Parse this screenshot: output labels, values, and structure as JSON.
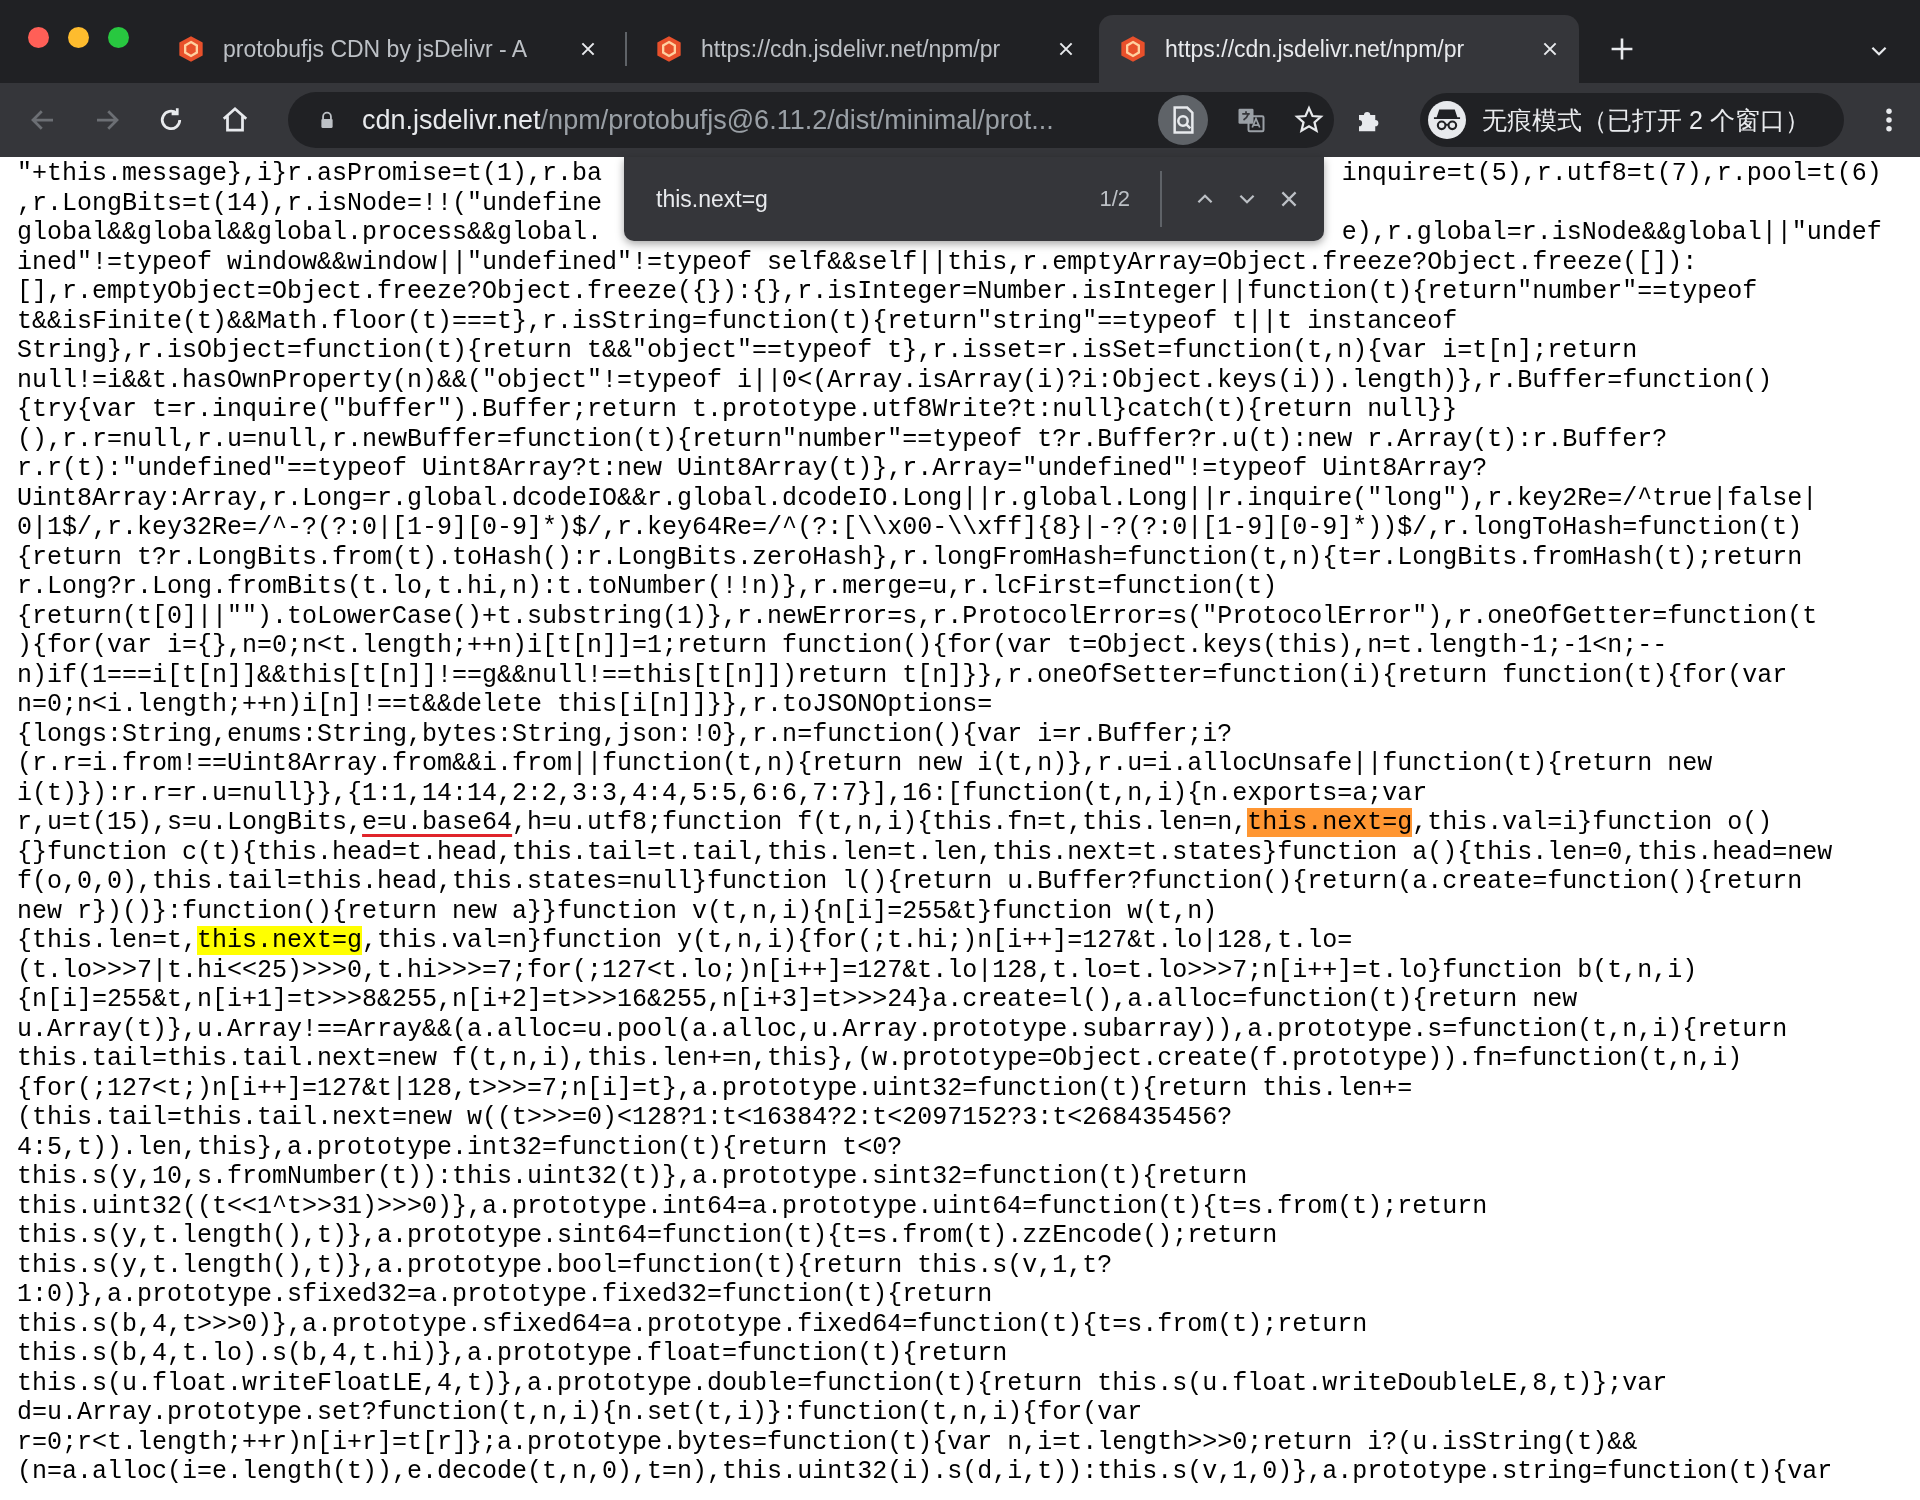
{
  "tabs": [
    {
      "title": "protobufjs CDN by jsDelivr - A",
      "selected": false
    },
    {
      "title": "https://cdn.jsdelivr.net/npm/pr",
      "selected": false
    },
    {
      "title": "https://cdn.jsdelivr.net/npm/pr",
      "selected": true
    }
  ],
  "nav_buttons": [
    {
      "kind": "back",
      "disabled": true
    },
    {
      "kind": "forward",
      "disabled": true
    },
    {
      "kind": "reload",
      "disabled": false
    },
    {
      "kind": "home",
      "disabled": false
    }
  ],
  "address_bar": {
    "host": "cdn.jsdelivr.net",
    "path": "/npm/protobufjs@6.11.2/dist/minimal/prot..."
  },
  "profile": {
    "label": "无痕模式（已打开 2 个窗口）"
  },
  "find_bar": {
    "query": "this.next=g",
    "count": "1/2"
  },
  "source_lines": [
    {
      "segments": [
        {
          "kind": "text",
          "text": "\"+this.message},i}r.asPromise=t(1),r.ba"
        }
      ],
      "right_text": "inquire=t(5),r.utf8=t(7),r.pool=t(6)"
    },
    {
      "segments": [
        {
          "kind": "text",
          "text": ",r.LongBits=t(14),r.isNode=!!(\"undefine"
        }
      ]
    },
    {
      "segments": [
        {
          "kind": "text",
          "text": "global&&global&&global.process&&global."
        }
      ],
      "right_text": "e),r.global=r.isNode&&global||\"undef"
    },
    {
      "segments": [
        {
          "kind": "text",
          "text": "ined\"!=typeof window&&window||\"undefined\"!=typeof self&&self||this,r.emptyArray=Object.freeze?Object.freeze([]):"
        }
      ]
    },
    {
      "segments": [
        {
          "kind": "text",
          "text": "[],r.emptyObject=Object.freeze?Object.freeze({}):{},r.isInteger=Number.isInteger||function(t){return\"number\"==typeof"
        }
      ]
    },
    {
      "segments": [
        {
          "kind": "text",
          "text": "t&&isFinite(t)&&Math.floor(t)===t},r.isString=function(t){return\"string\"==typeof t||t instanceof"
        }
      ]
    },
    {
      "segments": [
        {
          "kind": "text",
          "text": "String},r.isObject=function(t){return t&&\"object\"==typeof t},r.isset=r.isSet=function(t,n){var i=t[n];return"
        }
      ]
    },
    {
      "segments": [
        {
          "kind": "text",
          "text": "null!=i&&t.hasOwnProperty(n)&&(\"object\"!=typeof i||0<(Array.isArray(i)?i:Object.keys(i)).length)},r.Buffer=function()"
        }
      ]
    },
    {
      "segments": [
        {
          "kind": "text",
          "text": "{try{var t=r.inquire(\"buffer\").Buffer;return t.prototype.utf8Write?t:null}catch(t){return null}}"
        }
      ]
    },
    {
      "segments": [
        {
          "kind": "text",
          "text": "(),r.r=null,r.u=null,r.newBuffer=function(t){return\"number\"==typeof t?r.Buffer?r.u(t):new r.Array(t):r.Buffer?"
        }
      ]
    },
    {
      "segments": [
        {
          "kind": "text",
          "text": "r.r(t):\"undefined\"==typeof Uint8Array?t:new Uint8Array(t)},r.Array=\"undefined\"!=typeof Uint8Array?"
        }
      ]
    },
    {
      "segments": [
        {
          "kind": "text",
          "text": "Uint8Array:Array,r.Long=r.global.dcodeIO&&r.global.dcodeIO.Long||r.global.Long||r.inquire(\"long\"),r.key2Re=/^true|false|"
        }
      ]
    },
    {
      "segments": [
        {
          "kind": "text",
          "text": "0|1$/,r.key32Re=/^-?(?:0|[1-9][0-9]*)$/,r.key64Re=/^(?:[\\\\x00-\\\\xff]{8}|-?(?:0|[1-9][0-9]*))$/,r.longToHash=function(t)"
        }
      ]
    },
    {
      "segments": [
        {
          "kind": "text",
          "text": "{return t?r.LongBits.from(t).toHash():r.LongBits.zeroHash},r.longFromHash=function(t,n){t=r.LongBits.fromHash(t);return"
        }
      ]
    },
    {
      "segments": [
        {
          "kind": "text",
          "text": "r.Long?r.Long.fromBits(t.lo,t.hi,n):t.toNumber(!!n)},r.merge=u,r.lcFirst=function(t)"
        }
      ]
    },
    {
      "segments": [
        {
          "kind": "text",
          "text": "{return(t[0]||\"\").toLowerCase()+t.substring(1)},r.newError=s,r.ProtocolError=s(\"ProtocolError\"),r.oneOfGetter=function(t"
        }
      ]
    },
    {
      "segments": [
        {
          "kind": "text",
          "text": "){for(var i={},n=0;n<t.length;++n)i[t[n]]=1;return function(){for(var t=Object.keys(this),n=t.length-1;-1<n;--"
        }
      ]
    },
    {
      "segments": [
        {
          "kind": "text",
          "text": "n)if(1===i[t[n]]&&this[t[n]]!==g&&null!==this[t[n]])return t[n]}},r.oneOfSetter=function(i){return function(t){for(var"
        }
      ]
    },
    {
      "segments": [
        {
          "kind": "text",
          "text": "n=0;n<i.length;++n)i[n]!==t&&delete this[i[n]]}},r.toJSONOptions="
        }
      ]
    },
    {
      "segments": [
        {
          "kind": "text",
          "text": "{longs:String,enums:String,bytes:String,json:!0},r.n=function(){var i=r.Buffer;i?"
        }
      ]
    },
    {
      "segments": [
        {
          "kind": "text",
          "text": "(r.r=i.from!==Uint8Array.from&&i.from||function(t,n){return new i(t,n)},r.u=i.allocUnsafe||function(t){return new"
        }
      ]
    },
    {
      "segments": [
        {
          "kind": "text",
          "text": "i(t)}):r.r=r.u=null}},{1:1,14:14,2:2,3:3,4:4,5:5,6:6,7:7}],16:[function(t,n,i){n.exports=a;var"
        }
      ]
    },
    {
      "segments": [
        {
          "kind": "text",
          "text": "r,u=t(15),s=u.LongBits,"
        },
        {
          "kind": "underlined",
          "text": "e=u.base64"
        },
        {
          "kind": "text",
          "text": ",h=u.utf8;function f(t,n,i){this.fn=t,this.len=n,"
        },
        {
          "kind": "match",
          "selected": true,
          "text": "this.next=g"
        },
        {
          "kind": "text",
          "text": ",this.val=i}function o()"
        }
      ]
    },
    {
      "segments": [
        {
          "kind": "text",
          "text": "{}function c(t){this.head=t.head,this.tail=t.tail,this.len=t.len,this.next=t.states}function a(){this.len=0,this.head=new"
        }
      ]
    },
    {
      "segments": [
        {
          "kind": "text",
          "text": "f(o,0,0),this.tail=this.head,this.states=null}function l(){return u.Buffer?function(){return(a.create=function(){return"
        }
      ]
    },
    {
      "segments": [
        {
          "kind": "text",
          "text": "new r})()}:function(){return new a}}function v(t,n,i){n[i]=255&t}function w(t,n)"
        }
      ]
    },
    {
      "segments": [
        {
          "kind": "text",
          "text": "{this.len=t,"
        },
        {
          "kind": "match",
          "selected": false,
          "text": "this.next=g"
        },
        {
          "kind": "text",
          "text": ",this.val=n}function y(t,n,i){for(;t.hi;)n[i++]=127&t.lo|128,t.lo="
        }
      ]
    },
    {
      "segments": [
        {
          "kind": "text",
          "text": "(t.lo>>>7|t.hi<<25)>>>0,t.hi>>>=7;for(;127<t.lo;)n[i++]=127&t.lo|128,t.lo=t.lo>>>7;n[i++]=t.lo}function b(t,n,i)"
        }
      ]
    },
    {
      "segments": [
        {
          "kind": "text",
          "text": "{n[i]=255&t,n[i+1]=t>>>8&255,n[i+2]=t>>>16&255,n[i+3]=t>>>24}a.create=l(),a.alloc=function(t){return new"
        }
      ]
    },
    {
      "segments": [
        {
          "kind": "text",
          "text": "u.Array(t)},u.Array!==Array&&(a.alloc=u.pool(a.alloc,u.Array.prototype.subarray)),a.prototype.s=function(t,n,i){return"
        }
      ]
    },
    {
      "segments": [
        {
          "kind": "text",
          "text": "this.tail=this.tail.next=new f(t,n,i),this.len+=n,this},(w.prototype=Object.create(f.prototype)).fn=function(t,n,i)"
        }
      ]
    },
    {
      "segments": [
        {
          "kind": "text",
          "text": "{for(;127<t;)n[i++]=127&t|128,t>>>=7;n[i]=t},a.prototype.uint32=function(t){return this.len+="
        }
      ]
    },
    {
      "segments": [
        {
          "kind": "text",
          "text": "(this.tail=this.tail.next=new w((t>>>=0)<128?1:t<16384?2:t<2097152?3:t<268435456?"
        }
      ]
    },
    {
      "segments": [
        {
          "kind": "text",
          "text": "4:5,t)).len,this},a.prototype.int32=function(t){return t<0?"
        }
      ]
    },
    {
      "segments": [
        {
          "kind": "text",
          "text": "this.s(y,10,s.fromNumber(t)):this.uint32(t)},a.prototype.sint32=function(t){return"
        }
      ]
    },
    {
      "segments": [
        {
          "kind": "text",
          "text": "this.uint32((t<<1^t>>31)>>>0)},a.prototype.int64=a.prototype.uint64=function(t){t=s.from(t);return"
        }
      ]
    },
    {
      "segments": [
        {
          "kind": "text",
          "text": "this.s(y,t.length(),t)},a.prototype.sint64=function(t){t=s.from(t).zzEncode();return"
        }
      ]
    },
    {
      "segments": [
        {
          "kind": "text",
          "text": "this.s(y,t.length(),t)},a.prototype.bool=function(t){return this.s(v,1,t?"
        }
      ]
    },
    {
      "segments": [
        {
          "kind": "text",
          "text": "1:0)},a.prototype.sfixed32=a.prototype.fixed32=function(t){return"
        }
      ]
    },
    {
      "segments": [
        {
          "kind": "text",
          "text": "this.s(b,4,t>>>0)},a.prototype.sfixed64=a.prototype.fixed64=function(t){t=s.from(t);return"
        }
      ]
    },
    {
      "segments": [
        {
          "kind": "text",
          "text": "this.s(b,4,t.lo).s(b,4,t.hi)},a.prototype.float=function(t){return"
        }
      ]
    },
    {
      "segments": [
        {
          "kind": "text",
          "text": "this.s(u.float.writeFloatLE,4,t)},a.prototype.double=function(t){return this.s(u.float.writeDoubleLE,8,t)};var"
        }
      ]
    },
    {
      "segments": [
        {
          "kind": "text",
          "text": "d=u.Array.prototype.set?function(t,n,i){n.set(t,i)}:function(t,n,i){for(var"
        }
      ]
    },
    {
      "segments": [
        {
          "kind": "text",
          "text": "r=0;r<t.length;++r)n[i+r]=t[r]};a.prototype.bytes=function(t){var n,i=t.length>>>0;return i?(u.isString(t)&&"
        }
      ]
    },
    {
      "segments": [
        {
          "kind": "text",
          "text": "(n=a.alloc(i=e.length(t)),e.decode(t,n,0),t=n),this.uint32(i).s(d,i,t)):this.s(v,1,0)},a.prototype.string=function(t){var"
        }
      ]
    }
  ]
}
